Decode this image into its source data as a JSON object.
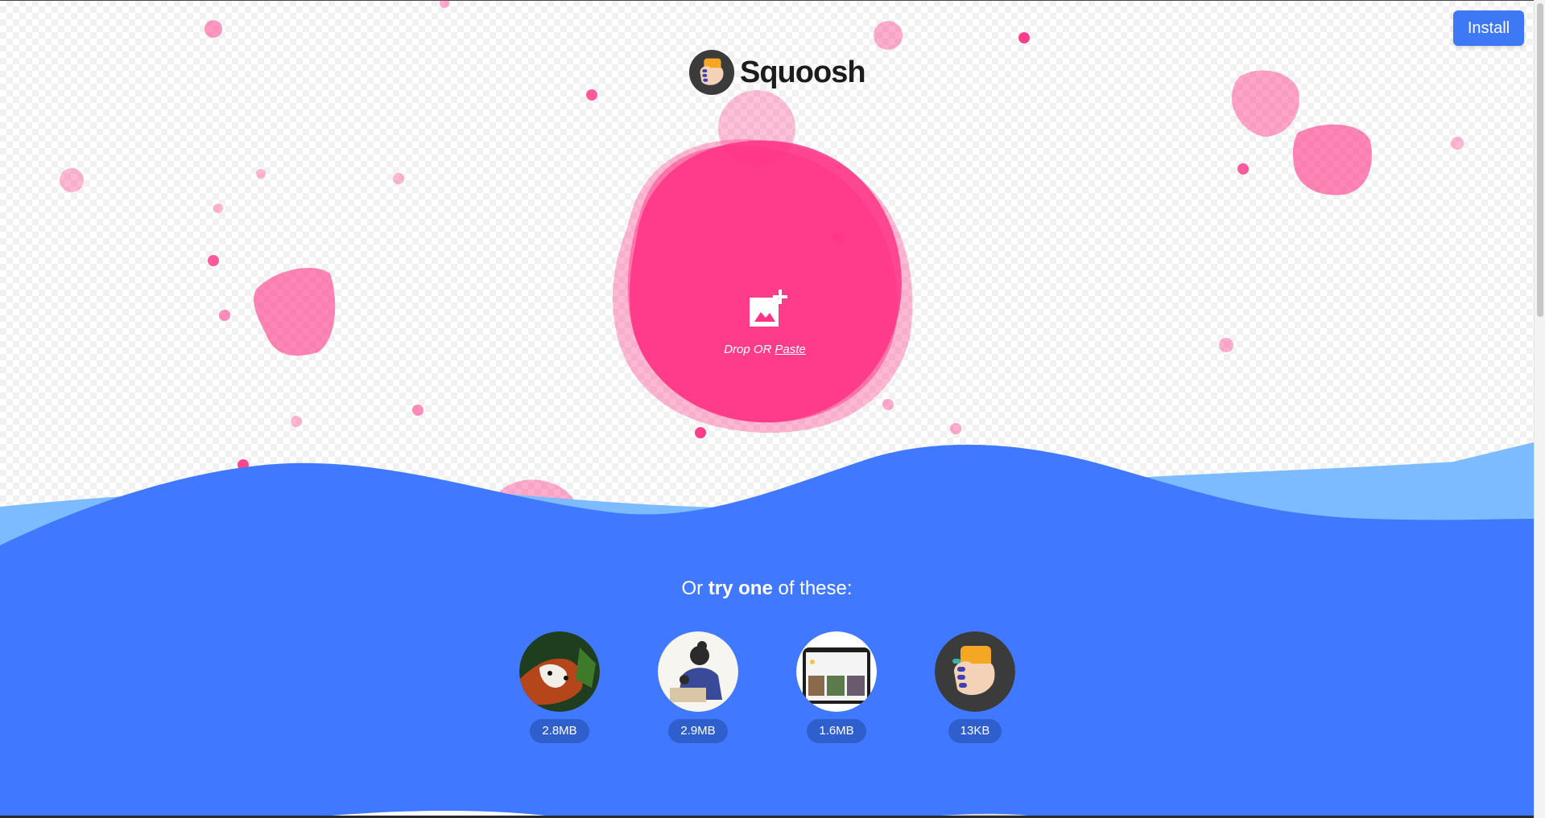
{
  "header": {
    "install_label": "Install",
    "logo_text": "Squoosh"
  },
  "drop_zone": {
    "icon": "add-image-icon",
    "text": "Drop OR",
    "paste_label": "Paste"
  },
  "demos": {
    "heading_prefix": "Or",
    "heading_bold": "try one",
    "heading_suffix": "of these:",
    "items": [
      {
        "thumb": "red-panda-photo",
        "size": "2.8MB"
      },
      {
        "thumb": "artwork-illustration",
        "size": "2.9MB"
      },
      {
        "thumb": "device-screenshot",
        "size": "1.6MB"
      },
      {
        "thumb": "squoosh-logo-icon",
        "size": "13KB"
      }
    ]
  },
  "colors": {
    "accent_pink": "#ff3385",
    "accent_blue": "#4079ff",
    "light_blue": "#7cbbff",
    "button_blue": "#3f78f5"
  }
}
